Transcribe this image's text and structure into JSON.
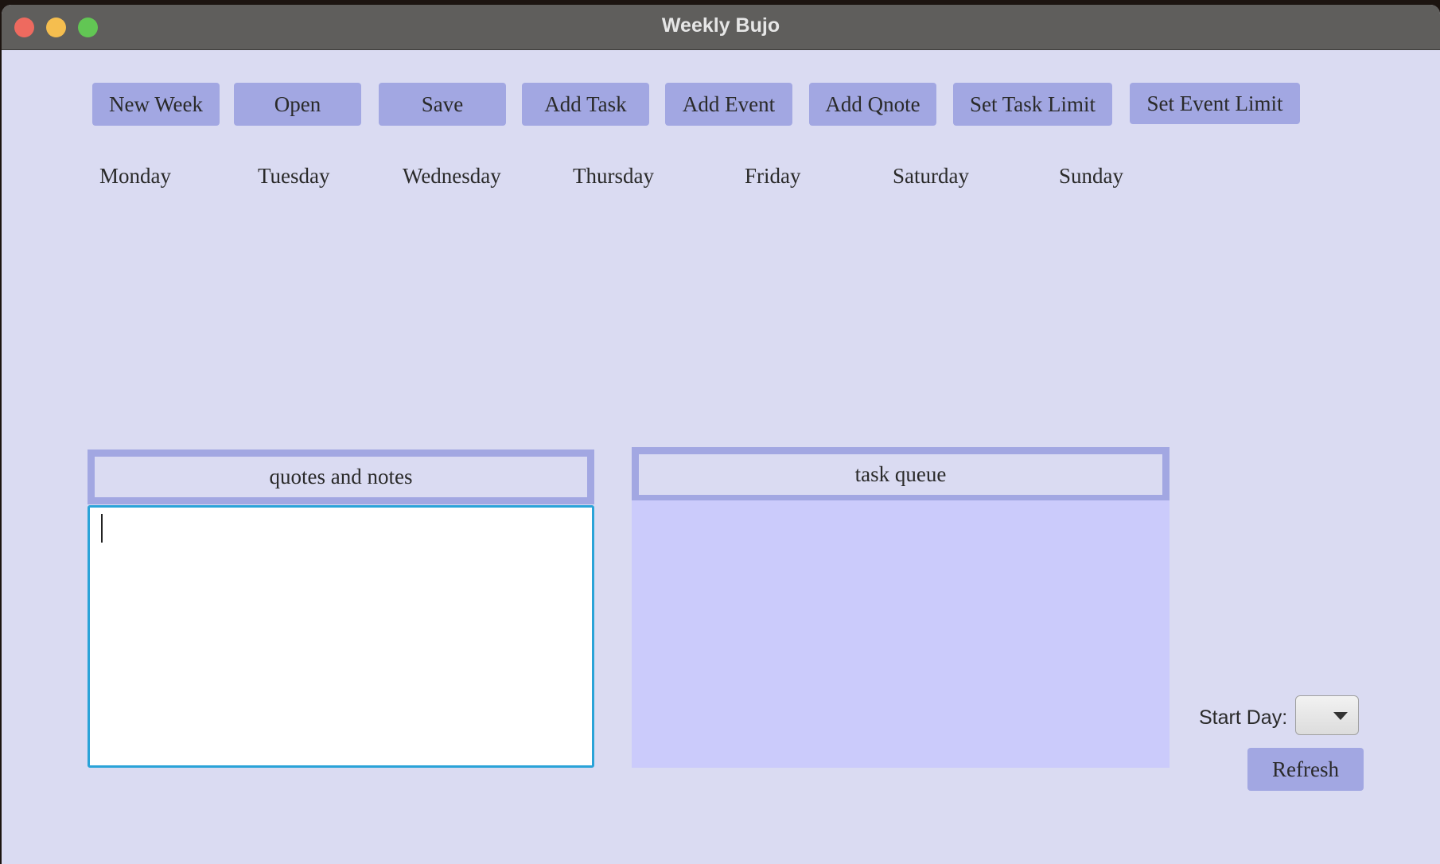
{
  "window": {
    "title": "Weekly Bujo"
  },
  "toolbar": {
    "new_week": "New Week",
    "open": "Open",
    "save": "Save",
    "add_task": "Add Task",
    "add_event": "Add Event",
    "add_quote": "Add Qnote",
    "set_task_limit": "Set Task Limit",
    "set_event_limit": "Set Event Limit"
  },
  "days": [
    "Monday",
    "Tuesday",
    "Wednesday",
    "Thursday",
    "Friday",
    "Saturday",
    "Sunday"
  ],
  "notes": {
    "header": "quotes and notes",
    "value": ""
  },
  "queue": {
    "header": "task queue"
  },
  "start_day": {
    "label": "Start Day:",
    "selected": ""
  },
  "refresh": {
    "label": "Refresh"
  },
  "colors": {
    "background": "#dadbf2",
    "button": "#a2a7e2",
    "queue_fill": "#cbcbfb",
    "focus_border": "#2aa3d8"
  }
}
